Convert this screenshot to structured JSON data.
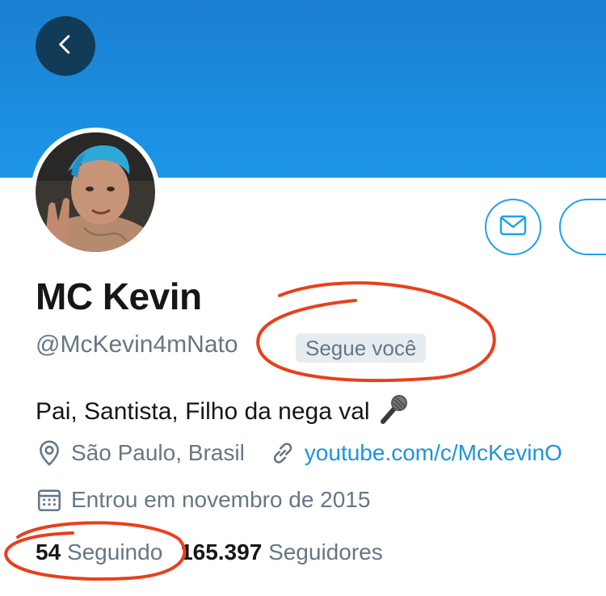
{
  "profile": {
    "name": "MC Kevin",
    "handle": "@McKevin4mNato",
    "follows_you_badge": "Segue você",
    "bio": "Pai, Santista, Filho da nega val",
    "location": "São Paulo, Brasil",
    "website": "youtube.com/c/McKevinO",
    "joined": "Entrou em novembro de 2015"
  },
  "stats": {
    "following_count": "54",
    "following_label": "Seguindo",
    "followers_count": "165.397",
    "followers_label": "Seguidores"
  },
  "icons": {
    "back": "chevron-left-icon",
    "message": "envelope-icon",
    "location": "map-pin-icon",
    "website": "link-icon",
    "joined": "calendar-icon",
    "bio_emoji": "microphone-icon"
  },
  "colors": {
    "banner": "#1d96e8",
    "accent": "#1da1f2",
    "link": "#1b95e0",
    "annotation": "#e8401c"
  }
}
